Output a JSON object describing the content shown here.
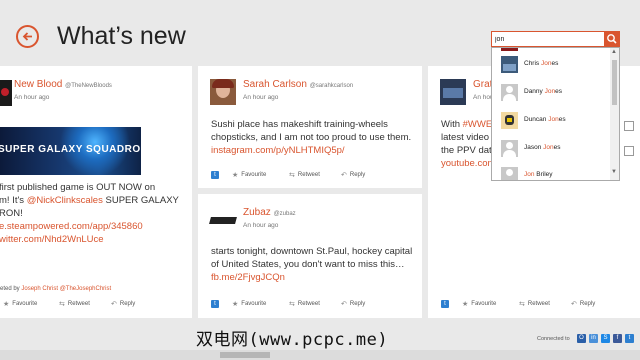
{
  "header": {
    "title": "What’s new"
  },
  "colors": {
    "accent": "#d9552f",
    "twitter": "#2d7fd0"
  },
  "cards": [
    {
      "author": "New Blood",
      "handle": "@TheNewBloods",
      "time": "An hour ago",
      "image_text": "SUPER GALAXY SQUADRON",
      "lines": [
        "first published game is OUT NOW on",
        "m! It's "
      ],
      "mention": "@NickClinkscales",
      "mention_after": " SUPER GALAXY",
      "line3": "RON!",
      "link1": "e.steampowered.com/app/345860",
      "link2": "witter.com/Nhd2WnLUce",
      "retweet_prefix": "eted by ",
      "retweet_name": "Joseph Christ",
      "retweet_handle": "@TheJosephChrist",
      "actions": {
        "favourite": "Favourite",
        "retweet": "Retweet",
        "reply": "Reply"
      }
    },
    {
      "author": "Sarah Carlson",
      "handle": "@sarahkcarlson",
      "time": "An hour ago",
      "text": "Sushi place has makeshift training-wheels chopsticks, and I am not too proud to use them.",
      "link": "instagram.com/p/yNLHTMIQ5p/",
      "actions": {
        "favourite": "Favourite",
        "retweet": "Retweet",
        "reply": "Reply"
      }
    },
    {
      "author": "Zubaz",
      "handle": "@zubaz",
      "time": "An hour ago",
      "text": "starts tonight, downtown St.Paul, hockey capital of United States, you don't want to miss this…",
      "link": "fb.me/2FjvgJCQn",
      "actions": {
        "favourite": "Favourite",
        "retweet": "Retweet",
        "reply": "Reply"
      }
    },
    {
      "author": "Grat",
      "handle": "",
      "time": "An hou",
      "lines": [
        "With ",
        "latest video",
        "the PPV dat",
        "youtube.com"
      ],
      "hashtag": "#WWE",
      "actions": {
        "favourite": "Favourite",
        "retweet": "Retweet",
        "reply": "Reply"
      }
    }
  ],
  "search": {
    "value": "jon",
    "results": [
      {
        "first": "Chris ",
        "match": "Jon",
        "rest": "es"
      },
      {
        "first": "Danny ",
        "match": "Jon",
        "rest": "es"
      },
      {
        "first": "Duncan ",
        "match": "Jon",
        "rest": "es"
      },
      {
        "first": "Jason ",
        "match": "Jon",
        "rest": "es"
      },
      {
        "first": "",
        "match": "Jon",
        "rest": " Briley"
      }
    ]
  },
  "footer": {
    "watermark": "双电网(www.pcpc.me)",
    "connected": "Connected to"
  }
}
